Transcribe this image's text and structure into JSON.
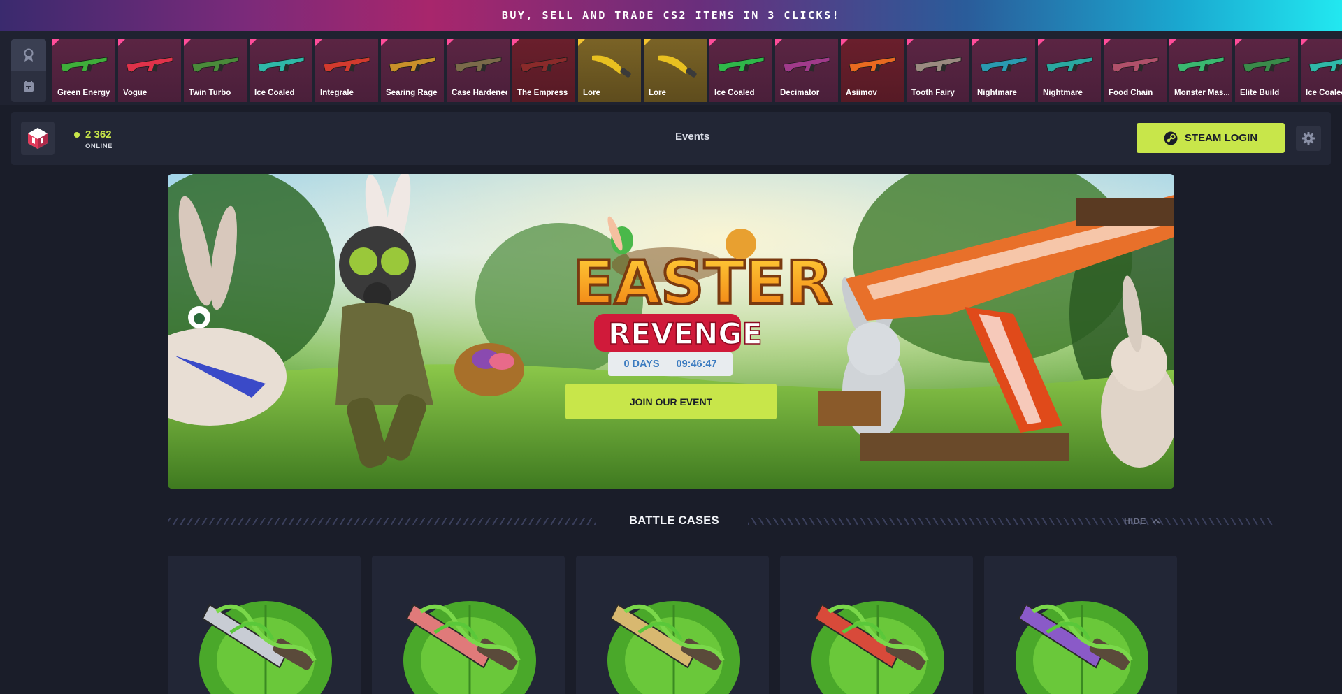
{
  "promo": {
    "text": "BUY, SELL AND TRADE CS2 ITEMS IN 3 CLICKS!"
  },
  "ticker": {
    "side_buttons": [
      "ribbon-icon",
      "calendar-icon"
    ],
    "drops": [
      {
        "name": "Green Energy",
        "rarity": "pink",
        "color": "#3fae3a"
      },
      {
        "name": "Vogue",
        "rarity": "pink",
        "color": "#e0324a"
      },
      {
        "name": "Twin Turbo",
        "rarity": "pink",
        "color": "#4a8a3a"
      },
      {
        "name": "Ice Coaled",
        "rarity": "pink",
        "color": "#2fb8a8"
      },
      {
        "name": "Integrale",
        "rarity": "pink",
        "color": "#d23a2e"
      },
      {
        "name": "Searing Rage",
        "rarity": "pink",
        "color": "#c8902a"
      },
      {
        "name": "Case Hardened",
        "rarity": "pink",
        "color": "#7a6a4a"
      },
      {
        "name": "The Empress",
        "rarity": "red",
        "color": "#8a2a2a"
      },
      {
        "name": "Lore",
        "rarity": "gold",
        "color": "#e8c020"
      },
      {
        "name": "Lore",
        "rarity": "gold",
        "color": "#e8c020"
      },
      {
        "name": "Ice Coaled",
        "rarity": "pink",
        "color": "#2fb84a"
      },
      {
        "name": "Decimator",
        "rarity": "pink",
        "color": "#a03a8a"
      },
      {
        "name": "Asiimov",
        "rarity": "red",
        "color": "#e86a20"
      },
      {
        "name": "Tooth Fairy",
        "rarity": "pink",
        "color": "#9a8a80"
      },
      {
        "name": "Nightmare",
        "rarity": "pink",
        "color": "#2a9ab0"
      },
      {
        "name": "Nightmare",
        "rarity": "pink",
        "color": "#2aa8a0"
      },
      {
        "name": "Food Chain",
        "rarity": "pink",
        "color": "#b0506a"
      },
      {
        "name": "Monster Mas...",
        "rarity": "pink",
        "color": "#3ab870"
      },
      {
        "name": "Elite Build",
        "rarity": "pink",
        "color": "#3a8a4a"
      },
      {
        "name": "Ice Coaled",
        "rarity": "pink",
        "color": "#2fb8a8"
      }
    ]
  },
  "header": {
    "online_count": "2 362",
    "online_label": "ONLINE",
    "nav_events": "Events",
    "steam_login": "STEAM LOGIN",
    "accent_color": "#c8e64a"
  },
  "hero": {
    "title_line1": "EASTER",
    "title_line2": "REVENGE",
    "countdown_days": "0 DAYS",
    "countdown_time": "09:46:47",
    "cta": "JOIN OUR EVENT"
  },
  "section": {
    "title": "BATTLE CASES",
    "hide_label": "HIDE"
  },
  "cases": [
    {
      "icon": "pistol-vine-icon",
      "blade": "#c8ccd4"
    },
    {
      "icon": "knuckle-knife-vine-icon",
      "blade": "#e07a7a"
    },
    {
      "icon": "dagger-vine-icon",
      "blade": "#d8b870"
    },
    {
      "icon": "bowie-knife-vine-icon",
      "blade": "#d84a3a"
    },
    {
      "icon": "karambit-vine-icon",
      "blade": "#8a5ac8"
    }
  ]
}
